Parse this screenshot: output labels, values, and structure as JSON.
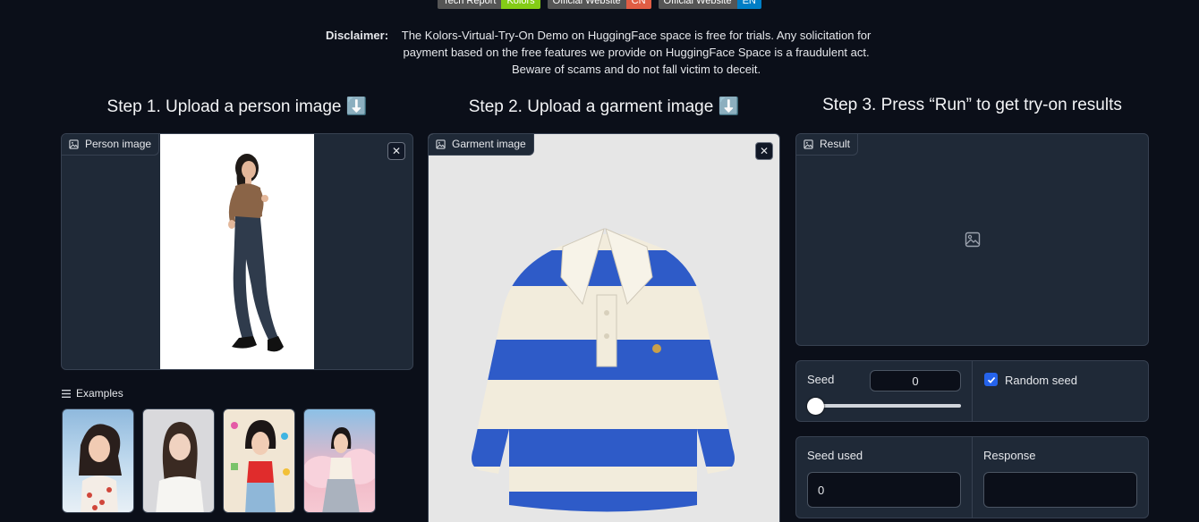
{
  "badges": [
    {
      "left": "Tech Report",
      "right": "Kolors",
      "color": "#84cc16"
    },
    {
      "left": "Official Website",
      "right": "CN",
      "color": "#e05d44"
    },
    {
      "left": "Official Website",
      "right": "EN",
      "color": "#007ec6"
    }
  ],
  "disclaimer": {
    "label": "Disclaimer:",
    "text": "The Kolors-Virtual-Try-On Demo on HuggingFace space is free for trials. Any solicitation for payment based on the free features we provide on HuggingFace Space is a fraudulent act. Beware of scams and do not fall victim to deceit."
  },
  "steps": {
    "step1": "Step 1. Upload a person image ⬇️",
    "step2": "Step 2. Upload a garment image ⬇️",
    "step3": "Step 3. Press “Run” to get try-on results"
  },
  "person": {
    "label": "Person image",
    "close": "✕"
  },
  "garment": {
    "label": "Garment image",
    "close": "✕"
  },
  "result": {
    "label": "Result"
  },
  "examples": {
    "label": "Examples"
  },
  "seed": {
    "label": "Seed",
    "value": "0",
    "slider_fraction": 0
  },
  "random_seed": {
    "label": "Random seed",
    "checked": true
  },
  "seed_used": {
    "label": "Seed used",
    "value": "0"
  },
  "response": {
    "label": "Response",
    "value": ""
  },
  "colors": {
    "accent": "#2563eb",
    "bg": "#0b0f19",
    "panel": "#1f2937"
  }
}
